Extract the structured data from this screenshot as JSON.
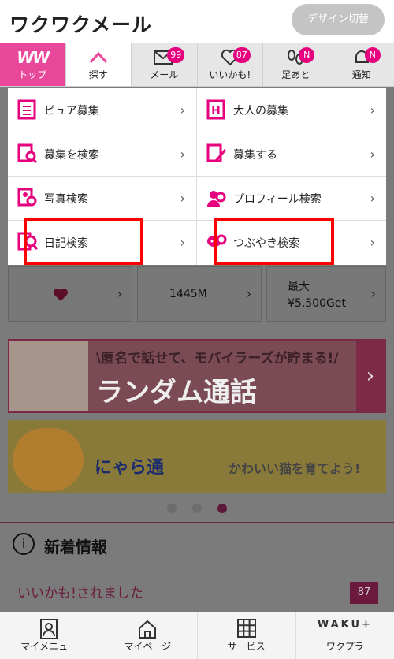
{
  "header": {
    "logo": "ワクワクメール",
    "design_switch": "デザイン切替"
  },
  "nav": [
    {
      "label": "トップ",
      "logo": "ww",
      "badge": null
    },
    {
      "label": "探す",
      "badge": null
    },
    {
      "label": "メール",
      "badge": "99"
    },
    {
      "label": "いいかも!",
      "badge": "87"
    },
    {
      "label": "足あと",
      "badge": "N"
    },
    {
      "label": "通知",
      "badge": "N"
    }
  ],
  "menu": [
    {
      "label": "ピュア募集",
      "icon": "document-icon"
    },
    {
      "label": "大人の募集",
      "icon": "h-icon"
    },
    {
      "label": "募集を検索",
      "icon": "search-document-icon"
    },
    {
      "label": "募集する",
      "icon": "write-icon"
    },
    {
      "label": "写真検索",
      "icon": "photo-search-icon"
    },
    {
      "label": "プロフィール検索",
      "icon": "profile-search-icon"
    },
    {
      "label": "日記検索",
      "icon": "diary-search-icon"
    },
    {
      "label": "つぶやき検索",
      "icon": "tweet-search-icon"
    }
  ],
  "stats": {
    "points": "1445M",
    "reward_line1": "最大",
    "reward_line2": "¥5,500Get"
  },
  "banners": {
    "random_call_top": "\\匿名で話せて、モバイラーズが貯まる!/",
    "random_call_main": "ランダム通話",
    "nyaratsu_title": "にゃら通",
    "nyaratsu_sub": "かわいい猫を育てよう!"
  },
  "news": {
    "title": "新着情報",
    "row_text": "いいかも!されました",
    "row_badge": "87"
  },
  "tabbar": [
    {
      "label": "マイメニュー"
    },
    {
      "label": "マイページ"
    },
    {
      "label": "サービス"
    },
    {
      "label": "ワクプラ",
      "brand": "WAKU+"
    }
  ],
  "colors": {
    "accent": "#e8479a",
    "badge": "#e6007e",
    "highlight": "#ff0000"
  }
}
